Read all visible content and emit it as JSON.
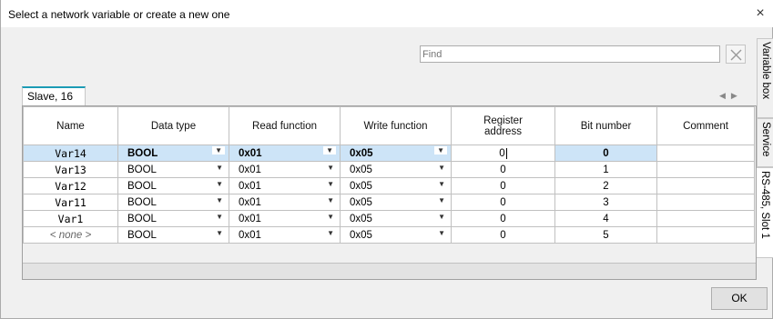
{
  "dialog": {
    "title": "Select a network variable or create a new one",
    "close_glyph": "×"
  },
  "search": {
    "placeholder": "Find",
    "clear_icon": "close-icon"
  },
  "tabs": {
    "active": "Slave, 16"
  },
  "side_tabs": [
    "Variable box",
    "Service",
    "RS-485, Slot 1"
  ],
  "grid": {
    "headers": [
      "Name",
      "Data type",
      "Read function",
      "Write function",
      "Register address",
      "Bit number",
      "Comment"
    ],
    "rows": [
      {
        "name": "Var14",
        "data_type": "BOOL",
        "read_fn": "0x01",
        "write_fn": "0x05",
        "register": "0",
        "bit": "0",
        "comment": ""
      },
      {
        "name": "Var13",
        "data_type": "BOOL",
        "read_fn": "0x01",
        "write_fn": "0x05",
        "register": "0",
        "bit": "1",
        "comment": ""
      },
      {
        "name": "Var12",
        "data_type": "BOOL",
        "read_fn": "0x01",
        "write_fn": "0x05",
        "register": "0",
        "bit": "2",
        "comment": ""
      },
      {
        "name": "Var11",
        "data_type": "BOOL",
        "read_fn": "0x01",
        "write_fn": "0x05",
        "register": "0",
        "bit": "3",
        "comment": ""
      },
      {
        "name": "Var1",
        "data_type": "BOOL",
        "read_fn": "0x01",
        "write_fn": "0x05",
        "register": "0",
        "bit": "4",
        "comment": ""
      },
      {
        "name": "< none >",
        "data_type": "BOOL",
        "read_fn": "0x01",
        "write_fn": "0x05",
        "register": "0",
        "bit": "5",
        "comment": ""
      }
    ]
  },
  "buttons": {
    "ok": "OK"
  },
  "colors": {
    "selected_row": "#cde4f7",
    "tab_accent": "#1c9bb5"
  }
}
